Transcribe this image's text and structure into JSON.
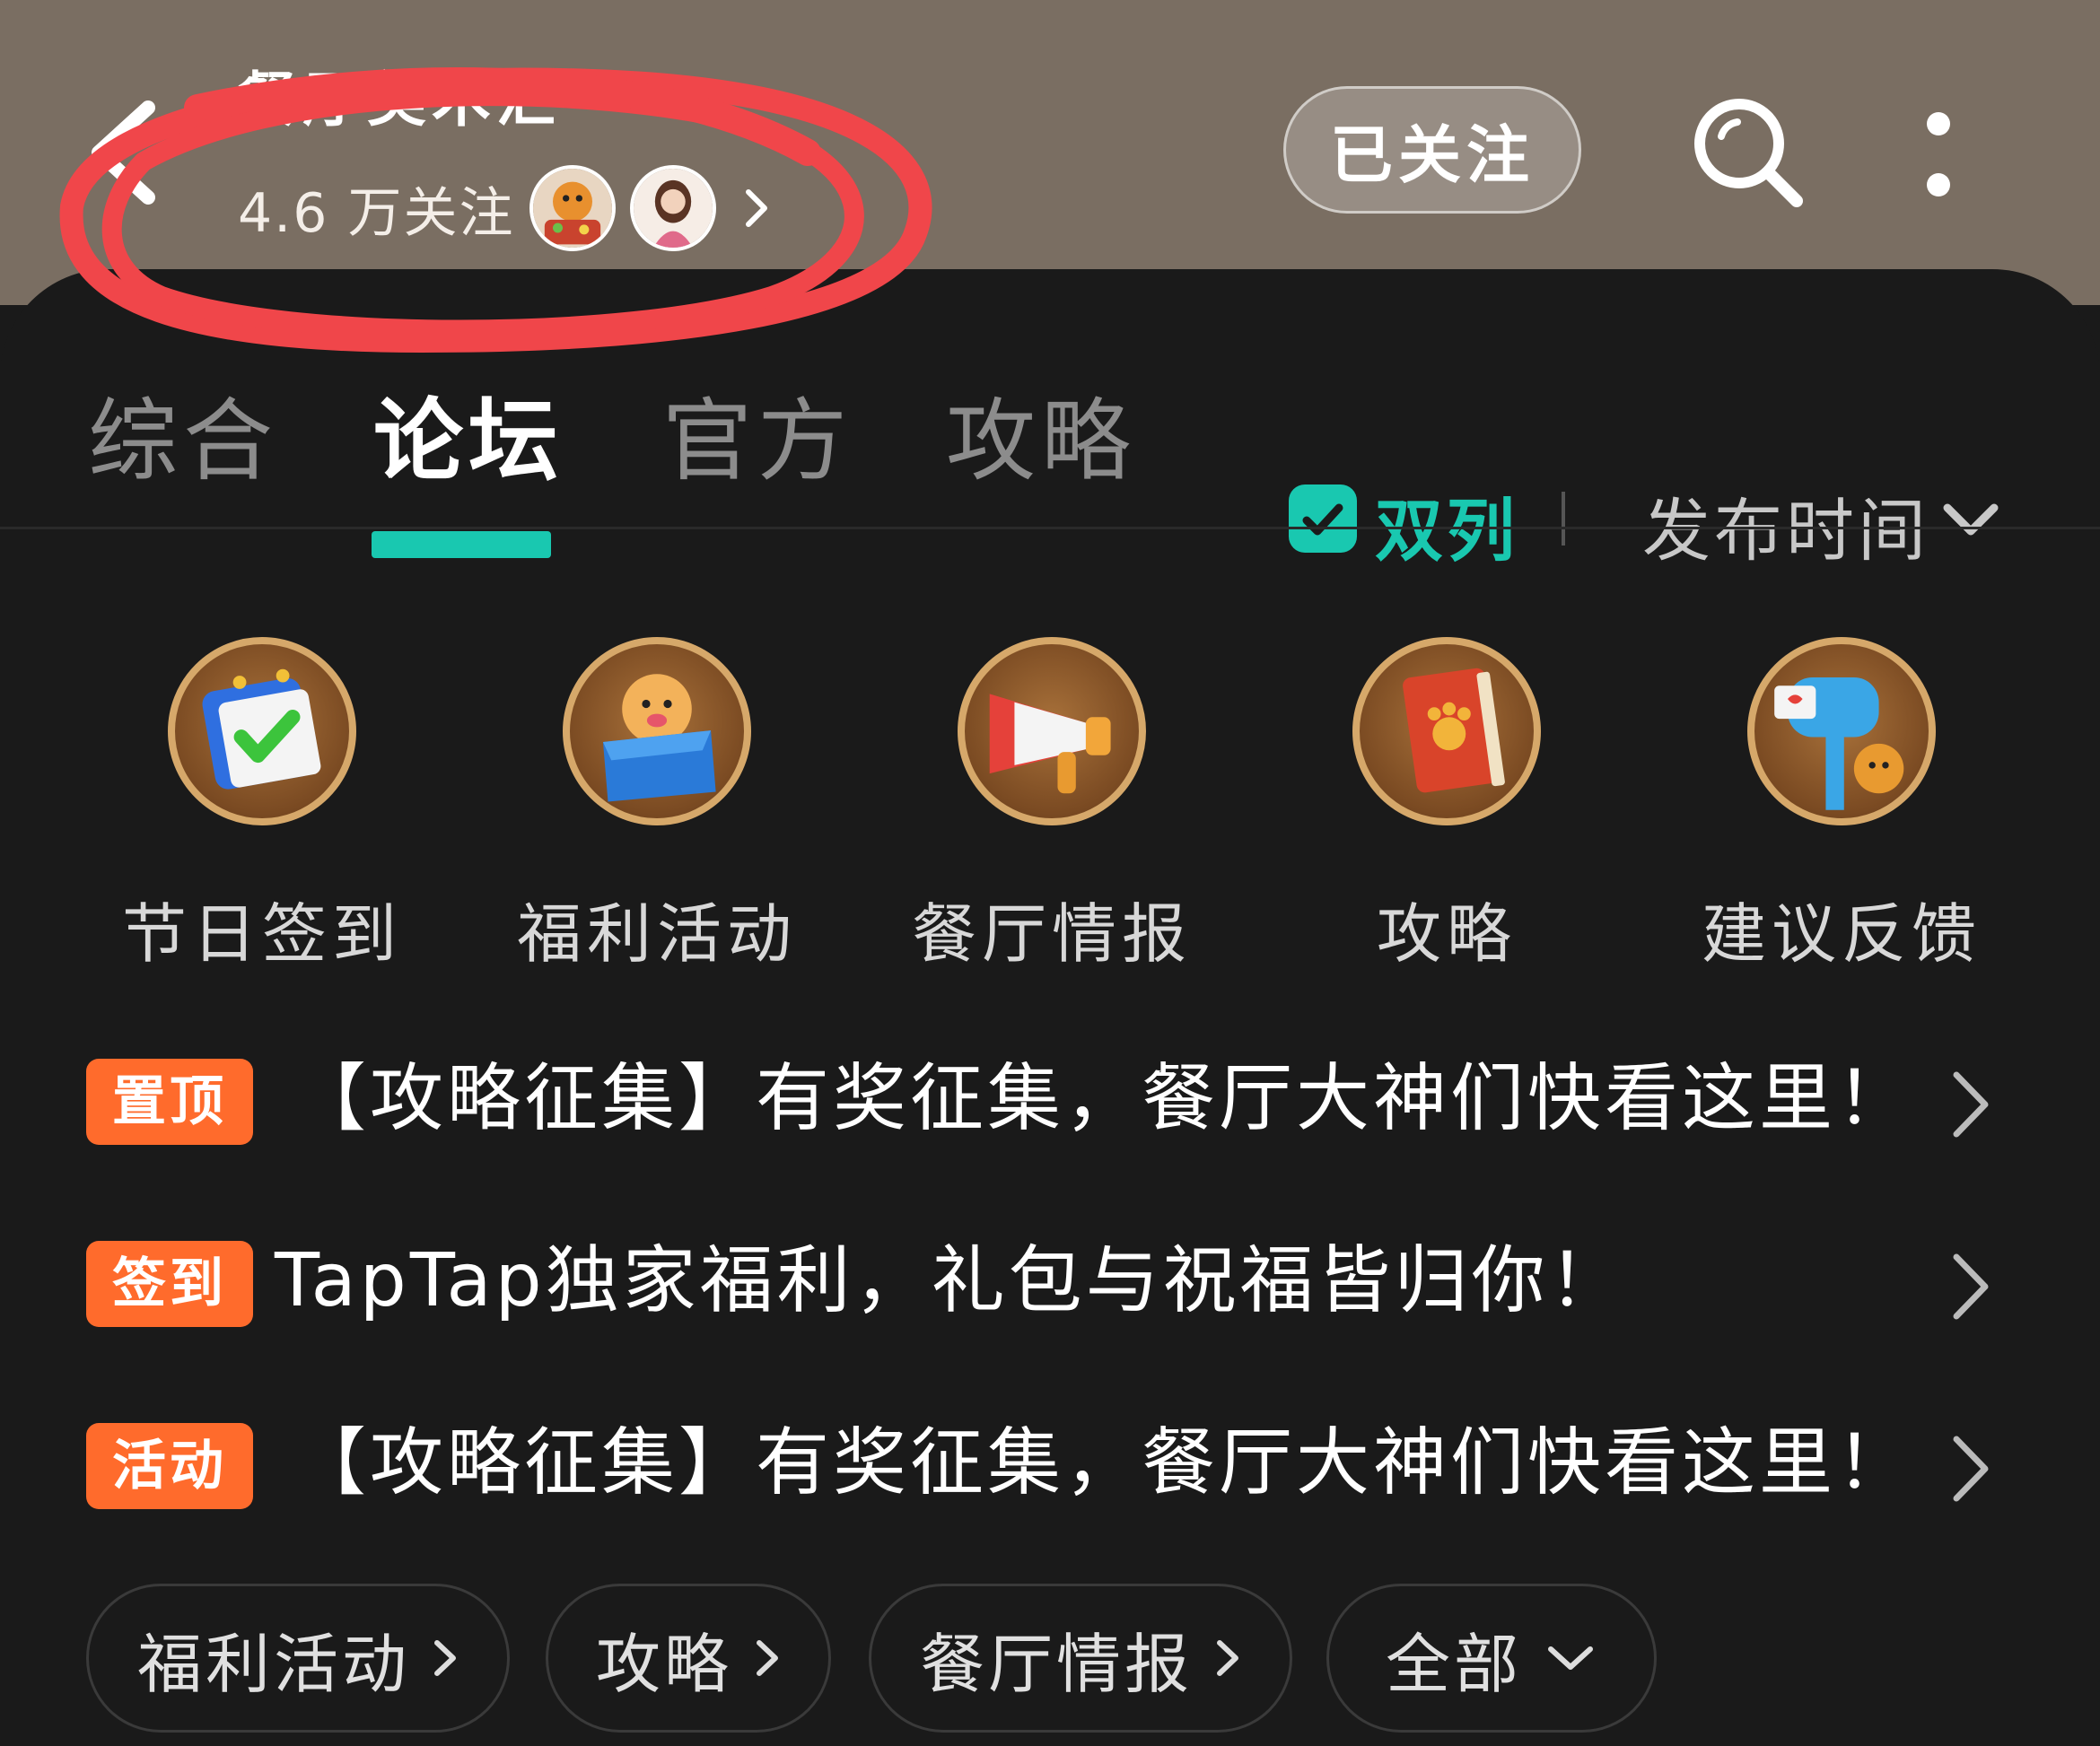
{
  "header": {
    "title": "餐厅美术汇",
    "followers": "4.6 万关注",
    "follow_button": "已关注",
    "bg_color": "#7a6e62"
  },
  "tabs": [
    {
      "label": "综合",
      "active": false
    },
    {
      "label": "论坛",
      "active": true
    },
    {
      "label": "官方",
      "active": false
    },
    {
      "label": "攻略",
      "active": false
    }
  ],
  "toolbar": {
    "dual_label": "双列",
    "dual_checked": true,
    "sort_label": "发布时间",
    "accent": "#19c8b0"
  },
  "shortcuts": [
    {
      "label": "节日签到",
      "icon": "calendar-checkin-icon"
    },
    {
      "label": "福利活动",
      "icon": "gift-box-dog-icon"
    },
    {
      "label": "餐厅情报",
      "icon": "megaphone-icon"
    },
    {
      "label": "攻略",
      "icon": "guide-book-icon"
    },
    {
      "label": "建议反馈",
      "icon": "mailbox-dog-icon"
    }
  ],
  "notices": [
    {
      "tag": "置顶",
      "text": "【攻略征集】有奖征集，餐厅大神们快看这里！"
    },
    {
      "tag": "签到",
      "text": "TapTap独家福利，礼包与祝福皆归你！"
    },
    {
      "tag": "活动",
      "text": "【攻略征集】有奖征集，餐厅大神们快看这里！"
    }
  ],
  "tag_color": "#ff6b2c",
  "chips": [
    {
      "label": "福利活动",
      "icon": "chevron-right-icon"
    },
    {
      "label": "攻略",
      "icon": "chevron-right-icon"
    },
    {
      "label": "餐厅情报",
      "icon": "chevron-right-icon"
    },
    {
      "label": "全部",
      "icon": "chevron-down-icon"
    }
  ]
}
